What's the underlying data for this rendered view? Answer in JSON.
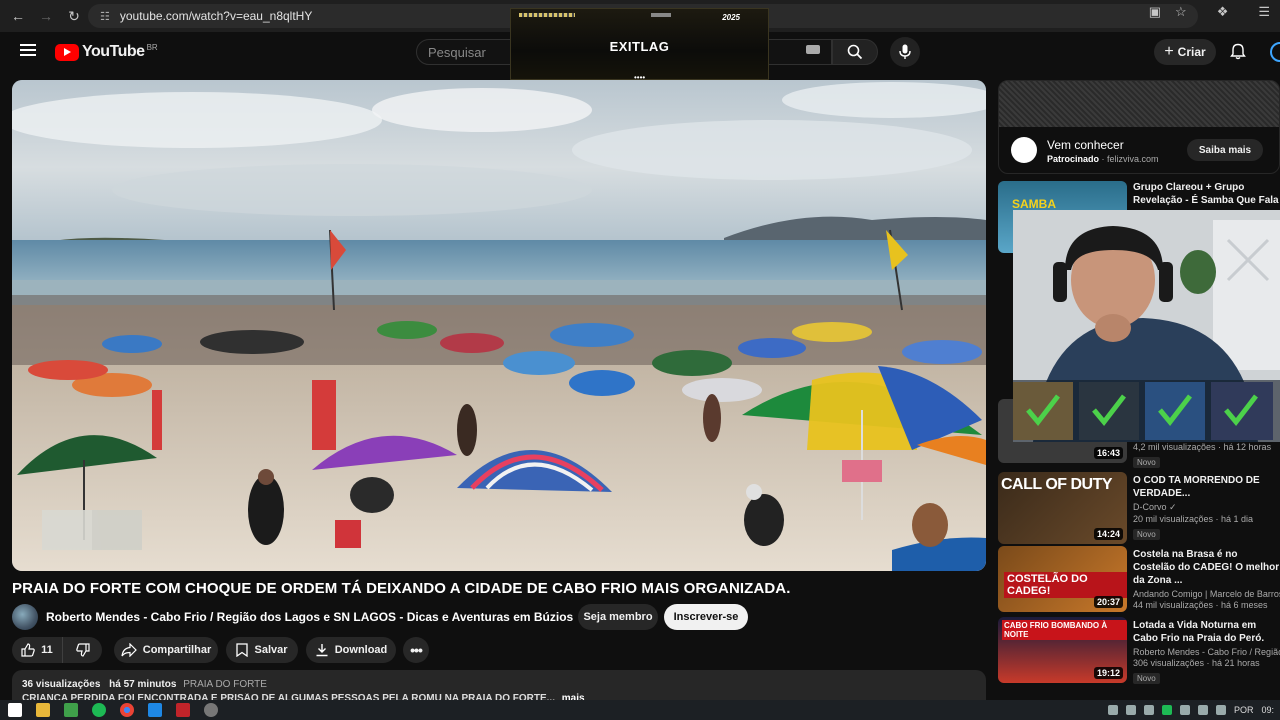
{
  "browser": {
    "url": "youtube.com/watch?v=eau_n8qltHY"
  },
  "header": {
    "logo_text": "YouTube",
    "country_code": "BR",
    "search_placeholder": "Pesquisar",
    "create_label": "Criar"
  },
  "exitlag": {
    "logo": "EXITLAG",
    "tag": "2025",
    "dots": "••••"
  },
  "video": {
    "title": "PRAIA DO FORTE COM CHOQUE DE ORDEM TÁ DEIXANDO A CIDADE DE CABO FRIO MAIS ORGANIZADA.",
    "channel": "Roberto Mendes - Cabo Frio / Região dos Lagos e SN LAGOS - Dicas e Aventuras em Búzios",
    "member_label": "Seja membro",
    "subscribe_label": "Inscrever-se",
    "likes": "11",
    "share_label": "Compartilhar",
    "save_label": "Salvar",
    "download_label": "Download",
    "views": "36 visualizações",
    "age": "há 57 minutos",
    "hashtag": "PRAIA DO FORTE",
    "description": "CRIANÇA PERDIDA FOI ENCONTRADA E PRISÃO DE ALGUMAS PESSOAS PELA ROMU NA PRAIA DO FORTE...",
    "more_label": "mais"
  },
  "ad": {
    "title": "Vem conhecer",
    "sponsored": "Patrocinado",
    "domain": "felizviva.com",
    "cta": "Saiba mais"
  },
  "recommendations": [
    {
      "title": "Grupo Clareou + Grupo Revelação - É Samba Que Fala",
      "channel": "",
      "views": "4,2 mil visualizações · há 12 horas",
      "duration": "16:43",
      "badge": "Novo",
      "thumb_text": "SAMBA"
    },
    {
      "title": "O COD TA MORRENDO DE VERDADE...",
      "channel": "D-Corvo ✓",
      "views": "20 mil visualizações · há 1 dia",
      "duration": "14:24",
      "badge": "Novo",
      "thumb_text": "CALL OF DUTY"
    },
    {
      "title": "Costela na Brasa é no Costelão do CADEG! O melhor da Zona ...",
      "channel": "Andando Comigo | Marcelo de Barros",
      "views": "44 mil visualizações · há 6 meses",
      "duration": "20:37",
      "badge": "",
      "thumb_text": "COSTELÃO DO CADEG!"
    },
    {
      "title": "Lotada a Vida Noturna em Cabo Frio na Praia do Peró.",
      "channel": "Roberto Mendes - Cabo Frio / Região",
      "views": "306 visualizações · há 21 horas",
      "duration": "19:12",
      "badge": "Novo",
      "thumb_text": "CABO FRIO BOMBANDO À NOITE"
    }
  ],
  "taskbar": {
    "language": "POR",
    "time": "09:"
  }
}
